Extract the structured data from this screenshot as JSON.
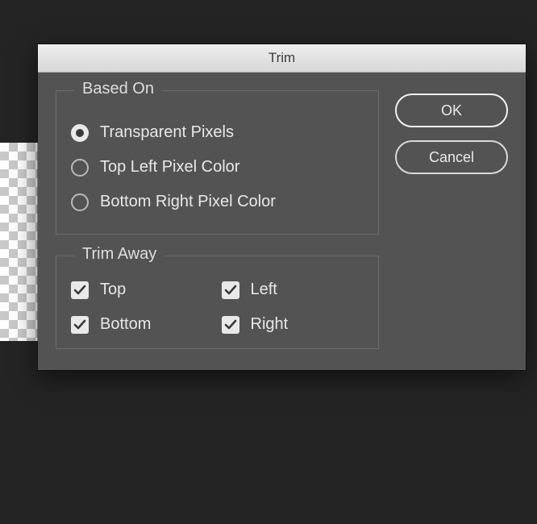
{
  "dialog": {
    "title": "Trim"
  },
  "basedOn": {
    "legend": "Based On",
    "options": [
      {
        "label": "Transparent Pixels",
        "checked": true
      },
      {
        "label": "Top Left Pixel Color",
        "checked": false
      },
      {
        "label": "Bottom Right Pixel Color",
        "checked": false
      }
    ]
  },
  "trimAway": {
    "legend": "Trim Away",
    "items": {
      "top": {
        "label": "Top",
        "checked": true
      },
      "bottom": {
        "label": "Bottom",
        "checked": true
      },
      "left": {
        "label": "Left",
        "checked": true
      },
      "right": {
        "label": "Right",
        "checked": true
      }
    }
  },
  "buttons": {
    "ok": "OK",
    "cancel": "Cancel"
  }
}
